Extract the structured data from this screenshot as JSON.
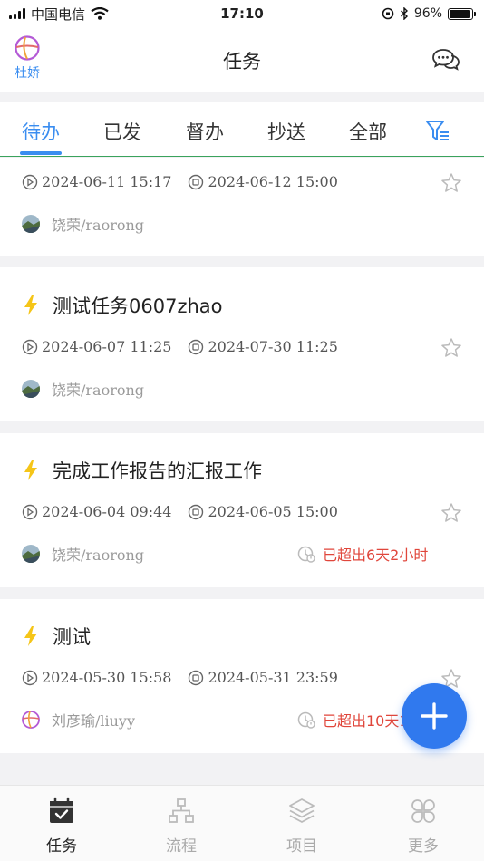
{
  "status_bar": {
    "carrier": "中国电信",
    "time": "17:10",
    "battery": "96%",
    "battery_level": 0.96
  },
  "header": {
    "user_name": "杜娇",
    "title": "任务"
  },
  "tabs": [
    {
      "label": "待办",
      "active": true
    },
    {
      "label": "已发",
      "active": false
    },
    {
      "label": "督办",
      "active": false
    },
    {
      "label": "抄送",
      "active": false
    },
    {
      "label": "全部",
      "active": false
    }
  ],
  "tasks": [
    {
      "title": "",
      "start": "2024-06-11 15:17",
      "end": "2024-06-12 15:00",
      "person": "饶荣/raorong",
      "overdue": ""
    },
    {
      "title": "测试任务0607zhao",
      "start": "2024-06-07 11:25",
      "end": "2024-07-30 11:25",
      "person": "饶荣/raorong",
      "overdue": ""
    },
    {
      "title": "完成工作报告的汇报工作",
      "start": "2024-06-04 09:44",
      "end": "2024-06-05 15:00",
      "person": "饶荣/raorong",
      "overdue": "已超出6天2小时"
    },
    {
      "title": "测试",
      "start": "2024-05-30 15:58",
      "end": "2024-05-31 23:59",
      "person": "刘彦瑜/liuyy",
      "overdue": "已超出10天1"
    }
  ],
  "bottom_nav": [
    {
      "label": "任务",
      "icon": "calendar-check-icon",
      "active": true
    },
    {
      "label": "流程",
      "icon": "flow-chart-icon",
      "active": false
    },
    {
      "label": "项目",
      "icon": "layers-icon",
      "active": false
    },
    {
      "label": "更多",
      "icon": "clover-icon",
      "active": false
    }
  ],
  "colors": {
    "accent": "#3a8df0",
    "fab": "#3079ee",
    "overdue": "#e0463b",
    "lightning": "#f5c518",
    "tab_border": "#3aa35c"
  }
}
